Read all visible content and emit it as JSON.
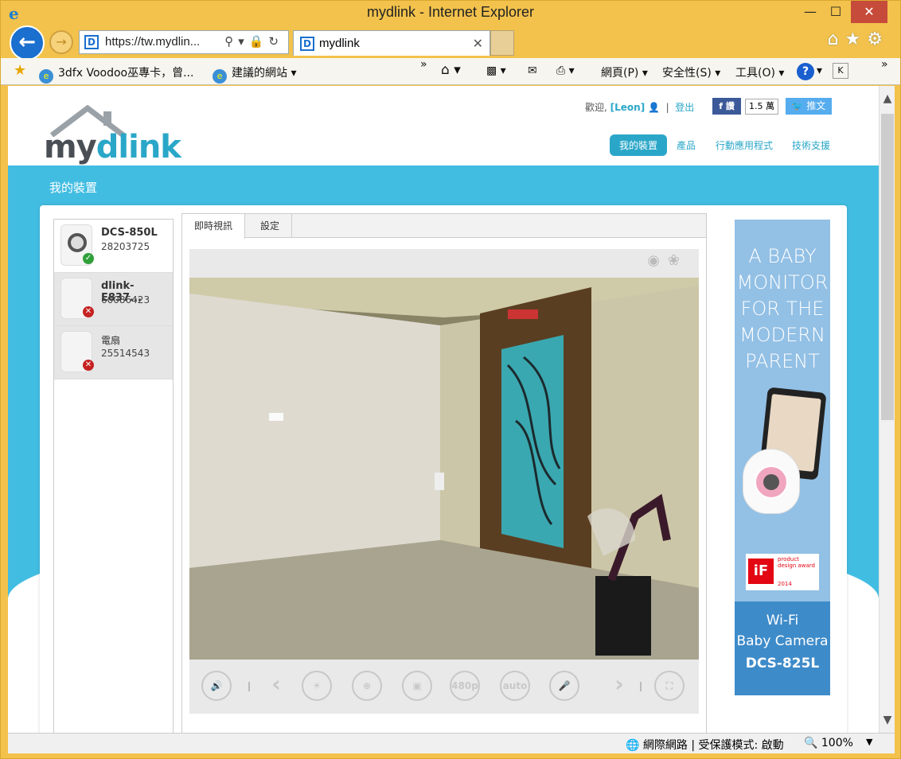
{
  "browser": {
    "title": "mydlink - Internet Explorer",
    "url": "https://tw.mydlin...",
    "tab_label": "mydlink",
    "favorites": [
      "3dfx Voodoo巫專卡，曾...",
      "建議的網站"
    ],
    "commands": [
      "網頁(P)",
      "安全性(S)",
      "工具(O)"
    ],
    "status_zone": "網際網路 | 受保護模式: 啟動",
    "zoom": "100%"
  },
  "page": {
    "logo_text_a": "my",
    "logo_text_b": "dlink",
    "welcome": "歡迎,",
    "user": "[Leon]",
    "logout": "登出",
    "fb_label": "讚",
    "fb_count": "1.5 萬",
    "tweet_label": "推文",
    "nav": [
      "我的裝置",
      "產品",
      "行動應用程式",
      "技術支援"
    ],
    "section_title": "我的裝置",
    "devices": [
      {
        "name": "DCS-850L",
        "sn": "28203725",
        "status": "online"
      },
      {
        "name": "dlink-E837...",
        "sn": "60086423",
        "status": "offline"
      },
      {
        "name": "電扇",
        "sn": "25514543",
        "status": "offline"
      }
    ],
    "tabs": [
      "即時視訊",
      "設定"
    ],
    "controls": [
      "480p",
      "auto"
    ],
    "ad": {
      "headline": [
        "A BABY",
        "MONITOR",
        "FOR THE",
        "MODERN",
        "PARENT"
      ],
      "award": "product design award",
      "award_year": "2014",
      "if_mark": "iF",
      "footer": [
        "Wi-Fi",
        "Baby Camera",
        "DCS-825L"
      ]
    }
  },
  "colors": {
    "accent": "#2aa7c8",
    "band": "#42bde2",
    "ie_frame": "#f3c24c"
  }
}
